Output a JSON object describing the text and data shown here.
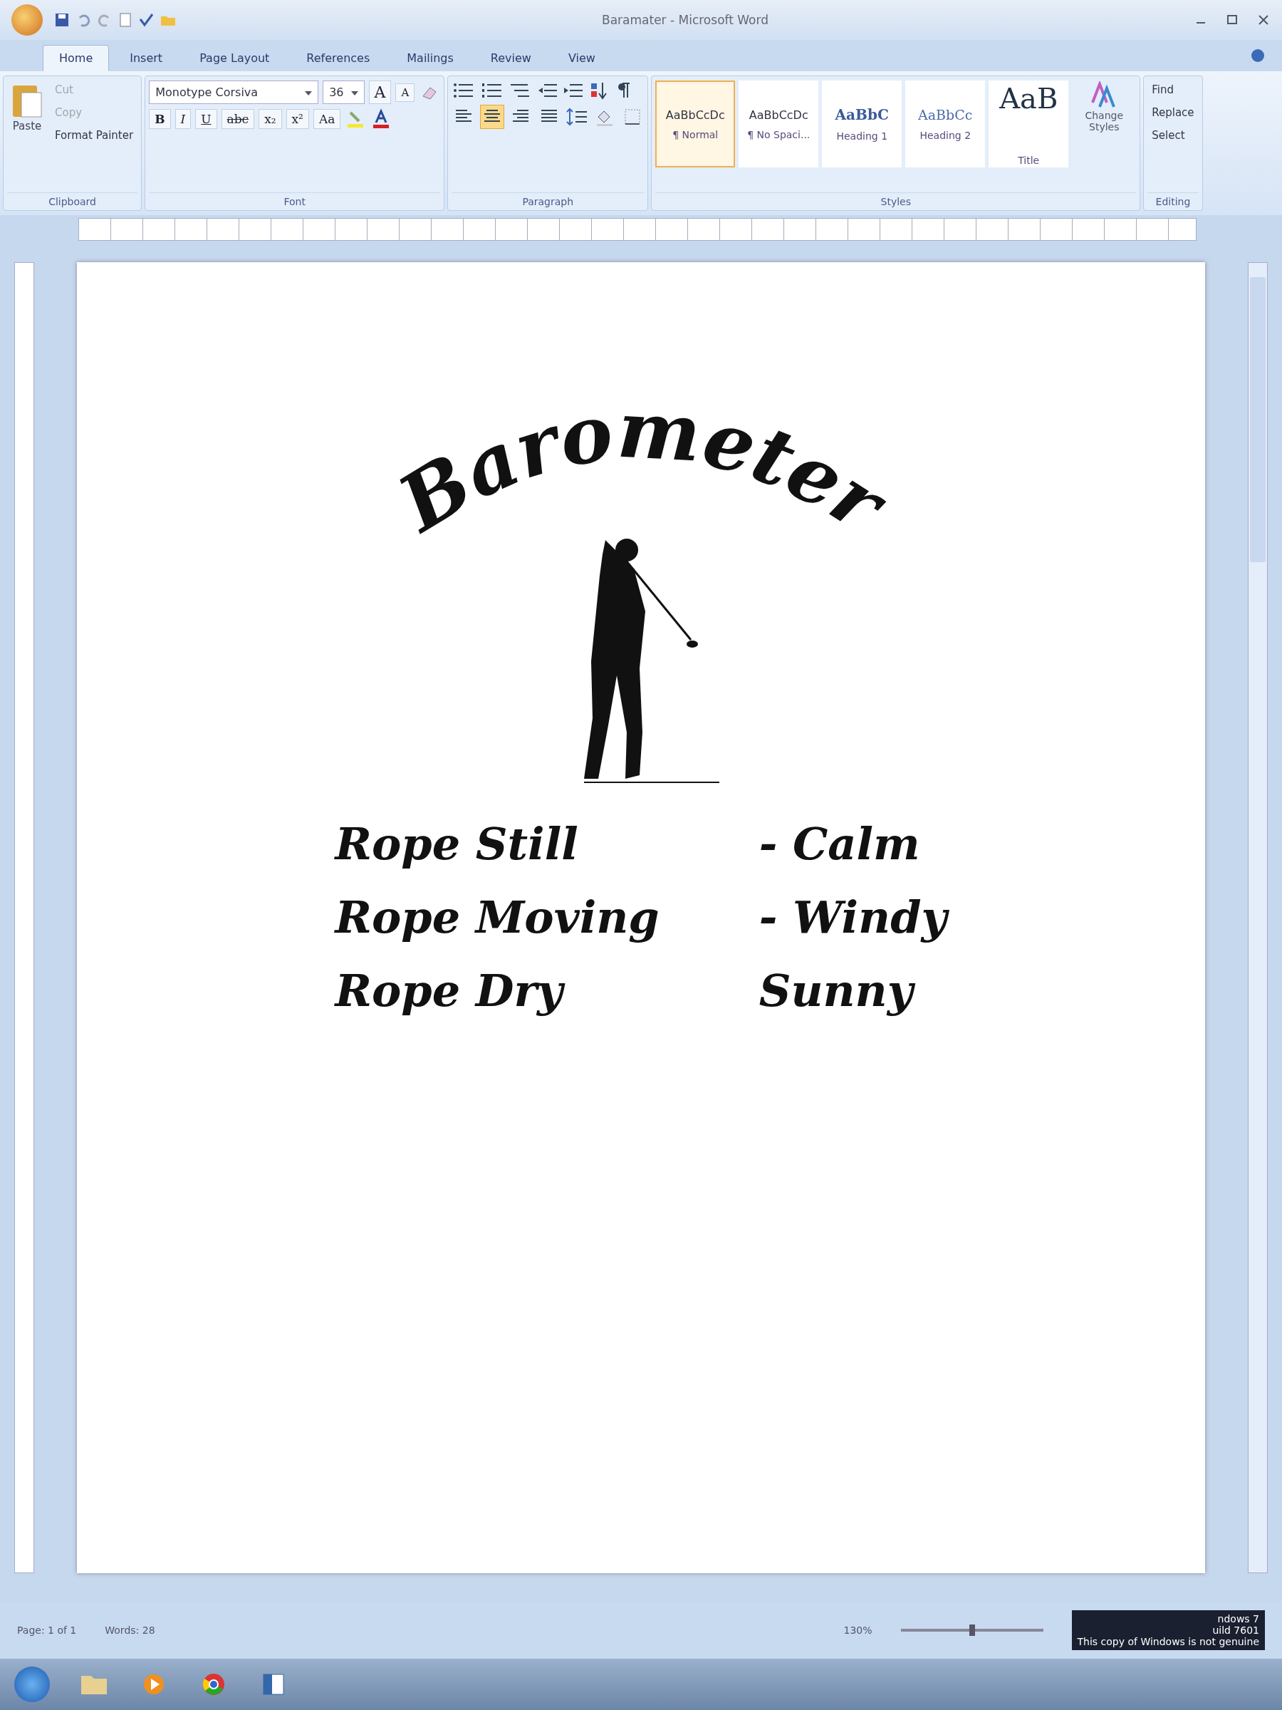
{
  "window": {
    "title": "Baramater - Microsoft Word"
  },
  "tabs": [
    {
      "label": "Home",
      "selected": true
    },
    {
      "label": "Insert",
      "selected": false
    },
    {
      "label": "Page Layout",
      "selected": false
    },
    {
      "label": "References",
      "selected": false
    },
    {
      "label": "Mailings",
      "selected": false
    },
    {
      "label": "Review",
      "selected": false
    },
    {
      "label": "View",
      "selected": false
    }
  ],
  "clipboard": {
    "paste": "Paste",
    "cut": "Cut",
    "copy": "Copy",
    "format_painter": "Format Painter",
    "label": "Clipboard"
  },
  "font": {
    "name": "Monotype Corsiva",
    "size": "36",
    "grow": "A",
    "shrink": "A",
    "format_buttons": [
      "B",
      "I",
      "U",
      "abc",
      "x₂",
      "x²",
      "Aa"
    ],
    "label": "Font"
  },
  "paragraph": {
    "alignments": [
      {
        "selected": false
      },
      {
        "selected": true
      },
      {
        "selected": false
      },
      {
        "selected": false
      }
    ],
    "label": "Paragraph"
  },
  "styles": {
    "items": [
      {
        "preview": "AaBbCcDc",
        "name": "¶ Normal",
        "selected": true,
        "kind": "body"
      },
      {
        "preview": "AaBbCcDc",
        "name": "¶ No Spaci...",
        "selected": false,
        "kind": "body"
      },
      {
        "preview": "AaBbC",
        "name": "Heading 1",
        "selected": false,
        "kind": "heading1"
      },
      {
        "preview": "AaBbCc",
        "name": "Heading 2",
        "selected": false,
        "kind": "heading2"
      },
      {
        "preview": "AaB",
        "name": "Title",
        "selected": false,
        "kind": "title"
      }
    ],
    "change_styles": "Change Styles",
    "label": "Styles"
  },
  "editing": {
    "find": "Find",
    "replace": "Replace",
    "select": "Select",
    "label": "Editing"
  },
  "document": {
    "heading": "Barometer",
    "lines": [
      {
        "left": "Rope Still",
        "right": "- Calm"
      },
      {
        "left": "Rope Moving",
        "right": "- Windy"
      },
      {
        "left": "Rope Dry",
        "right": "Sunny"
      }
    ]
  },
  "status_bar": {
    "page": "Page: 1 of 1",
    "words": "Words: 28",
    "zoom": "130%",
    "zoom_slider": {
      "level": 0.5
    }
  },
  "desktop_notice": [
    "ndows 7",
    "uild 7601",
    "This copy of Windows is not genuine"
  ]
}
